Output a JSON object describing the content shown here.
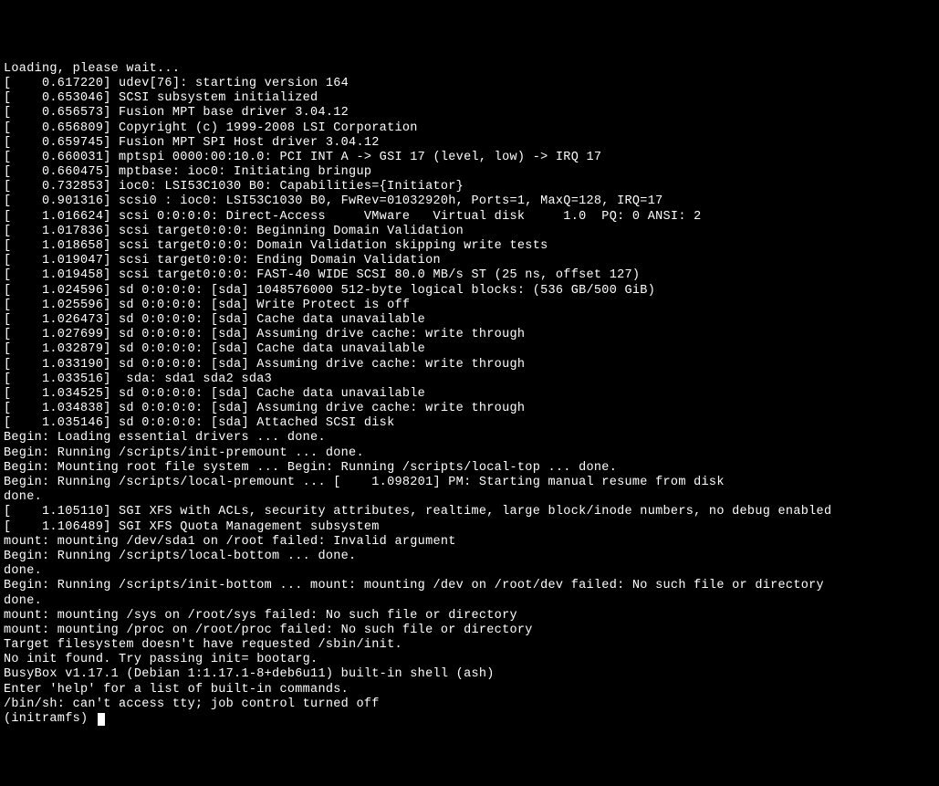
{
  "header": "Loading, please wait...",
  "kernel_lines": [
    "[    0.617220] udev[76]: starting version 164",
    "[    0.653046] SCSI subsystem initialized",
    "[    0.656573] Fusion MPT base driver 3.04.12",
    "[    0.656809] Copyright (c) 1999-2008 LSI Corporation",
    "[    0.659745] Fusion MPT SPI Host driver 3.04.12",
    "[    0.660031] mptspi 0000:00:10.0: PCI INT A -> GSI 17 (level, low) -> IRQ 17",
    "[    0.660475] mptbase: ioc0: Initiating bringup",
    "[    0.732853] ioc0: LSI53C1030 B0: Capabilities={Initiator}",
    "[    0.901316] scsi0 : ioc0: LSI53C1030 B0, FwRev=01032920h, Ports=1, MaxQ=128, IRQ=17",
    "[    1.016624] scsi 0:0:0:0: Direct-Access     VMware   Virtual disk     1.0  PQ: 0 ANSI: 2",
    "[    1.017836] scsi target0:0:0: Beginning Domain Validation",
    "[    1.018658] scsi target0:0:0: Domain Validation skipping write tests",
    "[    1.019047] scsi target0:0:0: Ending Domain Validation",
    "[    1.019458] scsi target0:0:0: FAST-40 WIDE SCSI 80.0 MB/s ST (25 ns, offset 127)",
    "[    1.024596] sd 0:0:0:0: [sda] 1048576000 512-byte logical blocks: (536 GB/500 GiB)",
    "[    1.025596] sd 0:0:0:0: [sda] Write Protect is off",
    "[    1.026473] sd 0:0:0:0: [sda] Cache data unavailable",
    "[    1.027699] sd 0:0:0:0: [sda] Assuming drive cache: write through",
    "[    1.032879] sd 0:0:0:0: [sda] Cache data unavailable",
    "[    1.033190] sd 0:0:0:0: [sda] Assuming drive cache: write through",
    "[    1.033516]  sda: sda1 sda2 sda3",
    "[    1.034525] sd 0:0:0:0: [sda] Cache data unavailable",
    "[    1.034838] sd 0:0:0:0: [sda] Assuming drive cache: write through",
    "[    1.035146] sd 0:0:0:0: [sda] Attached SCSI disk"
  ],
  "script_lines": [
    "Begin: Loading essential drivers ... done.",
    "Begin: Running /scripts/init-premount ... done.",
    "Begin: Mounting root file system ... Begin: Running /scripts/local-top ... done.",
    "Begin: Running /scripts/local-premount ... [    1.098201] PM: Starting manual resume from disk",
    "done.",
    "[    1.105110] SGI XFS with ACLs, security attributes, realtime, large block/inode numbers, no debug enabled",
    "[    1.106489] SGI XFS Quota Management subsystem",
    "mount: mounting /dev/sda1 on /root failed: Invalid argument",
    "Begin: Running /scripts/local-bottom ... done.",
    "done.",
    "Begin: Running /scripts/init-bottom ... mount: mounting /dev on /root/dev failed: No such file or directory",
    "done.",
    "mount: mounting /sys on /root/sys failed: No such file or directory",
    "mount: mounting /proc on /root/proc failed: No such file or directory",
    "Target filesystem doesn't have requested /sbin/init.",
    "No init found. Try passing init= bootarg.",
    "",
    "",
    "BusyBox v1.17.1 (Debian 1:1.17.1-8+deb6u11) built-in shell (ash)",
    "Enter 'help' for a list of built-in commands.",
    "",
    "/bin/sh: can't access tty; job control turned off"
  ],
  "prompt": "(initramfs) "
}
